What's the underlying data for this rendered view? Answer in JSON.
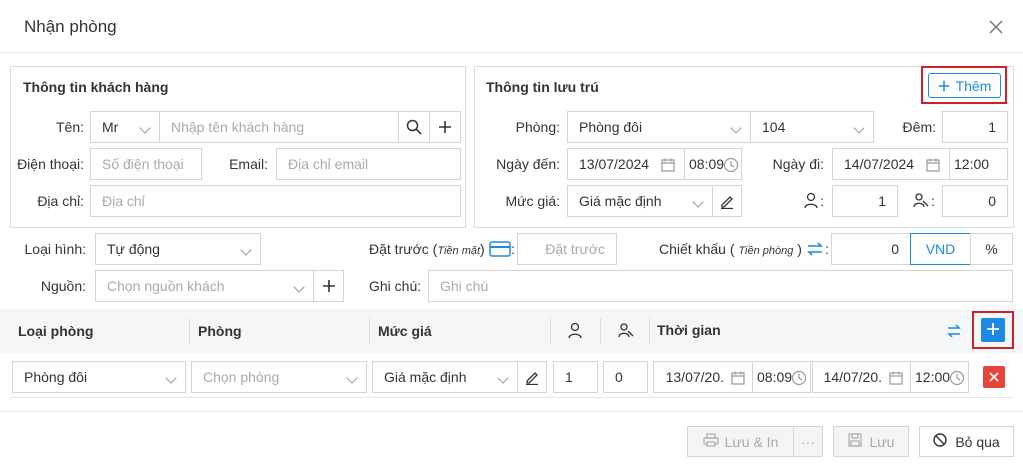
{
  "dialog": {
    "title": "Nhận phòng"
  },
  "customer": {
    "heading": "Thông tin khách hàng",
    "name_label": "Tên:",
    "salutation": "Mr",
    "name_placeholder": "Nhập tên khách hàng",
    "phone_label": "Điện thoại:",
    "phone_placeholder": "Số điện thoại",
    "email_label": "Email:",
    "email_placeholder": "Địa chỉ email",
    "address_label": "Địa chỉ:",
    "address_placeholder": "Địa chỉ"
  },
  "stay": {
    "heading": "Thông tin lưu trú",
    "add_label": "Thêm",
    "room_label": "Phòng:",
    "room_type": "Phòng đôi",
    "room_number": "104",
    "nights_label": "Đêm:",
    "nights": "1",
    "arrival_label": "Ngày đến:",
    "arrival_date": "13/07/2024",
    "arrival_time": "08:09",
    "departure_label": "Ngày đi:",
    "departure_date": "14/07/2024",
    "departure_time": "12:00",
    "price_label": "Mức giá:",
    "price": "Giá mặc định",
    "adults": "1",
    "children": "0"
  },
  "booking": {
    "type_label": "Loại hình:",
    "type_value": "Tự động",
    "deposit_label": "Đặt trước",
    "deposit_hint": "Tiền mặt",
    "deposit_colon": ":",
    "deposit_placeholder": "Đặt trước",
    "discount_label": "Chiết khấu",
    "discount_hint": "Tiền phòng",
    "discount_colon": ":",
    "discount_value": "0",
    "currency_vnd": "VND",
    "currency_pct": "%",
    "source_label": "Nguồn:",
    "source_placeholder": "Chọn nguồn khách",
    "note_label": "Ghi chú:",
    "note_placeholder": "Ghi chú"
  },
  "table": {
    "headers": {
      "room_type": "Loại phòng",
      "room": "Phòng",
      "price": "Mức giá",
      "time": "Thời gian"
    },
    "row": {
      "room_type": "Phòng đôi",
      "room_placeholder": "Chọn phòng",
      "price": "Giá mặc định",
      "adults": "1",
      "children": "0",
      "from_date": "13/07/20.",
      "from_time": "08:09",
      "to_date": "14/07/20.",
      "to_time": "12:00"
    }
  },
  "footer": {
    "save_print": "Lưu & In",
    "more": "···",
    "save": "Lưu",
    "skip": "Bỏ qua"
  },
  "colors": {
    "accent": "#1e88e5",
    "danger": "#e8443a",
    "highlight": "#d0212a"
  }
}
